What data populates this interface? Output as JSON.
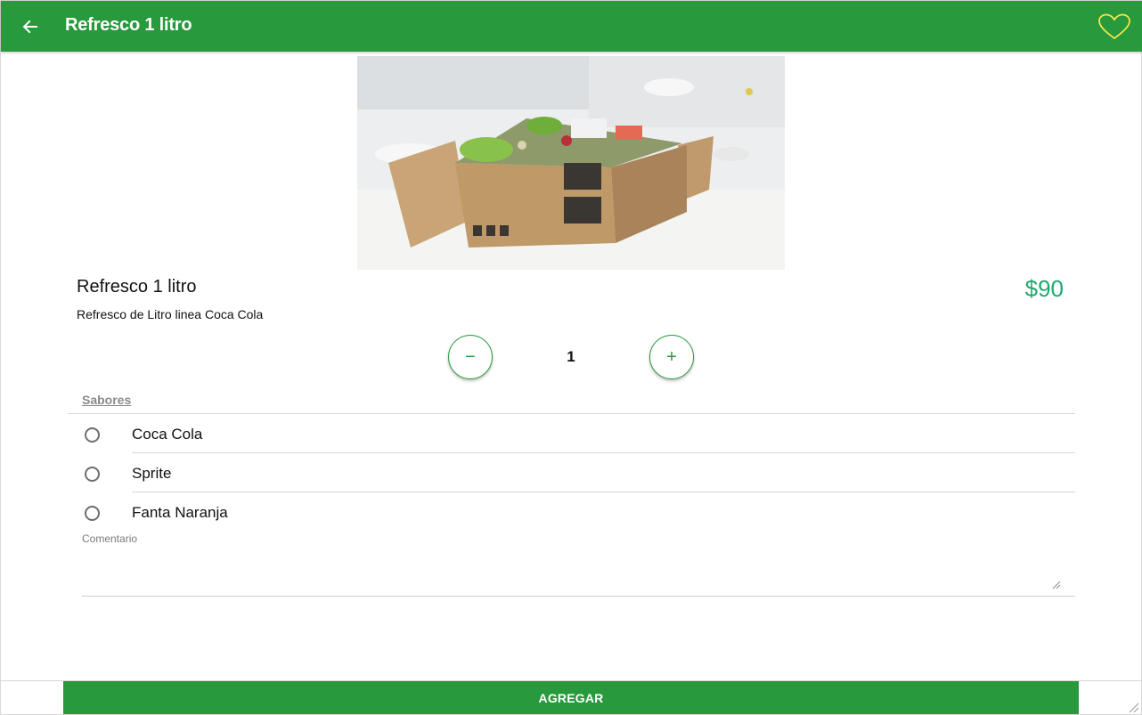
{
  "header": {
    "title": "Refresco 1 litro",
    "back_icon": "arrow-left-icon",
    "favorite_icon": "heart-outline-icon",
    "background_color": "#28993c",
    "favorite_color": "#f2e84a"
  },
  "product": {
    "name": "Refresco 1 litro",
    "description": "Refresco de Litro linea Coca Cola",
    "price": "$90",
    "price_color": "#1fa971",
    "image": "grocery-box-photo"
  },
  "quantity": {
    "value": "1",
    "minus_label": "−",
    "plus_label": "+"
  },
  "flavors": {
    "label": "Sabores",
    "options": [
      {
        "label": "Coca Cola",
        "selected": false
      },
      {
        "label": "Sprite",
        "selected": false
      },
      {
        "label": "Fanta Naranja",
        "selected": false
      }
    ]
  },
  "comment": {
    "label": "Comentario",
    "value": ""
  },
  "footer": {
    "add_label": "AGREGAR",
    "button_color": "#28993c"
  }
}
